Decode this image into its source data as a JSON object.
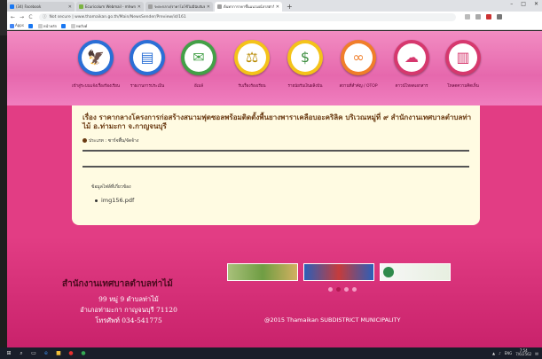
{
  "browser": {
    "tabs": [
      {
        "title": "(34) Facebook",
        "icon": "facebook-icon",
        "active": false
      },
      {
        "title": "Ecuricolum Webmail - mhwnvd4 ...",
        "icon": "webmail-icon",
        "active": false
      },
      {
        "title": "ระยะกลาง/ราคาโอโซ้ไม่มีนับสัมพันธ์",
        "icon": "doc-icon",
        "active": false
      },
      {
        "title": "ต้นทาการาคาขึ้นแนวมณ์ลาสต่ากิน",
        "icon": "doc-icon",
        "active": true
      }
    ],
    "new_tab": "+",
    "window_controls": {
      "minimize": "–",
      "maximize": "□",
      "close": "✕"
    },
    "nav": {
      "back": "←",
      "forward": "→",
      "reload": "C"
    },
    "url": "Not secure | www.thamaikan.go.th/Main/NewsSender/Preview/id/161",
    "bookmarks": [
      "Apps",
      "หน้าหลัก",
      "ทดลิงค์",
      "ทดลิงค์"
    ]
  },
  "header": {
    "menu": [
      {
        "label": "เข้าสู่ระบบแจ้งเรื่องร้องเรียน",
        "icon": "thai-emblem-icon",
        "color": "#2a6fd6"
      },
      {
        "label": "รายงานการประเมิน",
        "icon": "document-icon",
        "color": "#2a6fd6"
      },
      {
        "label": "อีเมล์",
        "icon": "email-icon",
        "color": "#43a047"
      },
      {
        "label": "รับเรื่องร้องเรียน",
        "icon": "scales-icon",
        "color": "#f4c31a"
      },
      {
        "label": "รายนัยรับเงินผลิงปัน",
        "icon": "money-icon",
        "color": "#f4c31a"
      },
      {
        "label": "สถานที่สำคัญ / OTOP",
        "icon": "binoculars-icon",
        "color": "#f07e2a"
      },
      {
        "label": "ดาวน์โหลดเอกสาร",
        "icon": "cloud-download-icon",
        "color": "#d6386e"
      },
      {
        "label": "โหลดความคิดเห็น",
        "icon": "chart-icon",
        "color": "#d6386e"
      }
    ]
  },
  "article": {
    "title": "เรื่อง ราคากลางโครงการก่อสร้างสนามฟุตซอลพร้อมติดตั้งพื้นยางพาราเคลือบอะคริลิค บริเวณหมู่ที่ ๙ สำนักงานเทศบาลตำบลท่าไม้ อ.ท่ามะกา จ.กาญจนบุรี",
    "category": "ประเภท : ซาร์จพื้น/จัดจ้าง",
    "attachments_heading": "ข้อมูลไฟล์ที่เกี่ยวข้อง",
    "attachments": [
      "img156.pdf"
    ]
  },
  "footer": {
    "org_name": "สำนักงานเทศบาลตำบลท่าไม้",
    "address_lines": [
      "99 หมู่ 9 ตำบลท่าไม้",
      "อำเภอท่ามะกา กาญจนบุรี 71120",
      "โทรศัพท์ 034-541775"
    ],
    "copyright": "@2015 Thamaikan SUBDISTRICT MUNICIPALITY",
    "banners": [
      "banner-1",
      "banner-2",
      "banner-3"
    ],
    "carousel_active_index": 1,
    "carousel_count": 4
  },
  "taskbar": {
    "time": "7:54",
    "date": "7/6/2562",
    "lang": "ENG"
  }
}
